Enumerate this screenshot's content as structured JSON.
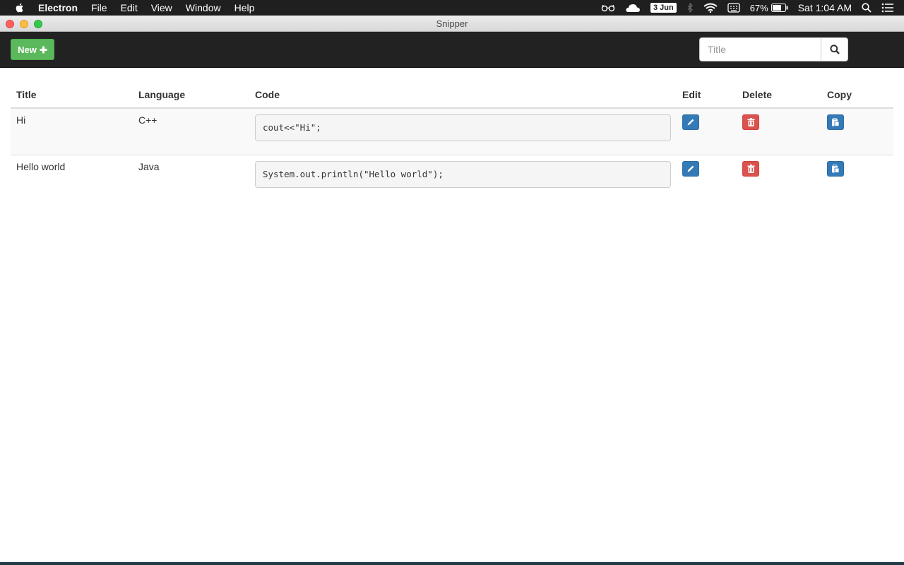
{
  "menubar": {
    "app_name": "Electron",
    "menus": [
      "File",
      "Edit",
      "View",
      "Window",
      "Help"
    ],
    "date_badge": "3 Jun",
    "battery_percent": "67%",
    "clock": "Sat 1:04 AM"
  },
  "window": {
    "title": "Snipper"
  },
  "navbar": {
    "new_button_label": "New",
    "search_placeholder": "Title",
    "search_value": ""
  },
  "table": {
    "headers": {
      "title": "Title",
      "language": "Language",
      "code": "Code",
      "edit": "Edit",
      "delete": "Delete",
      "copy": "Copy"
    },
    "rows": [
      {
        "title": "Hi",
        "language": "C++",
        "code": "cout<<\"Hi\";"
      },
      {
        "title": "Hello world",
        "language": "Java",
        "code": "System.out.println(\"Hello world\");"
      }
    ]
  },
  "colors": {
    "success": "#5cb85c",
    "primary": "#337ab7",
    "danger": "#d9534f",
    "navbar": "#222222"
  }
}
